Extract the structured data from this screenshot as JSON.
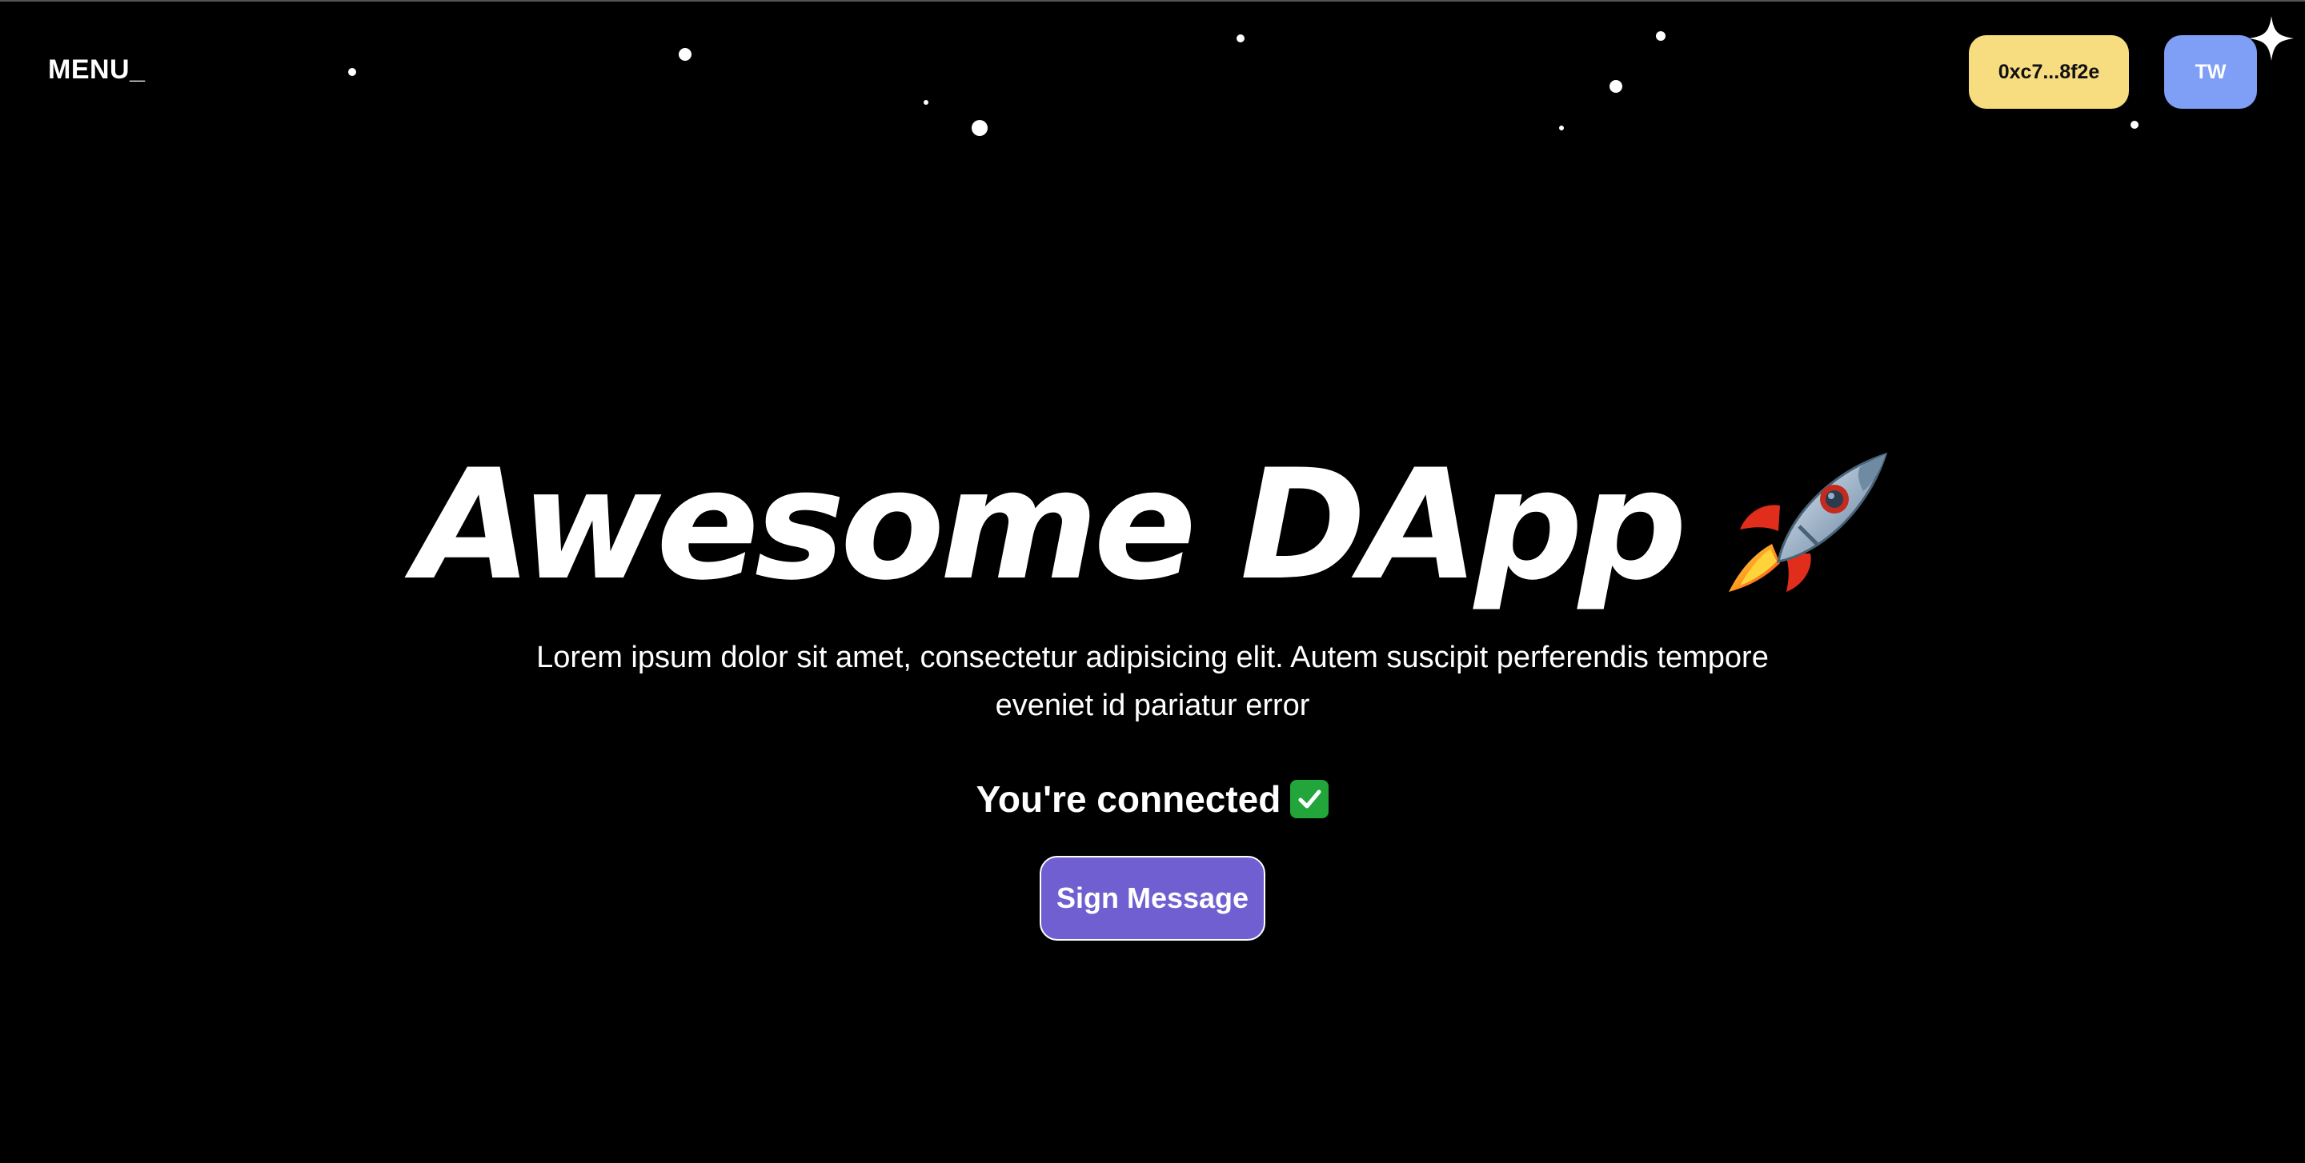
{
  "header": {
    "menu_label": "MENU_",
    "wallet_address": "0xc7...8f2e",
    "tw_label": "TW"
  },
  "hero": {
    "title": "Awesome DApp",
    "title_icon": "rocket-icon",
    "description": "Lorem ipsum dolor sit amet, consectetur adipisicing elit. Autem suscipit perferendis tempore eveniet id pariatur error",
    "status_text": "You're connected",
    "status_icon": "check-mark-icon",
    "sign_button_label": "Sign Message"
  },
  "colors": {
    "background": "#000000",
    "wallet_button": "#f7dc80",
    "tw_button": "#7f9ef5",
    "sign_button": "#6f5fd1",
    "check": "#22a53a"
  }
}
